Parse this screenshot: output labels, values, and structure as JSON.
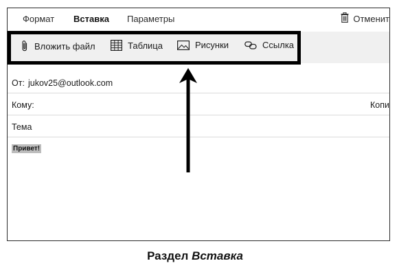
{
  "menu": {
    "tabs": [
      {
        "label": "Формат"
      },
      {
        "label": "Вставка"
      },
      {
        "label": "Параметры"
      }
    ],
    "discard_label": "Отменит"
  },
  "toolbar": {
    "items": [
      {
        "label": "Вложить файл",
        "icon": "paperclip-icon"
      },
      {
        "label": "Таблица",
        "icon": "table-icon"
      },
      {
        "label": "Рисунки",
        "icon": "picture-icon"
      },
      {
        "label": "Ссылка",
        "icon": "link-icon"
      }
    ]
  },
  "compose": {
    "from_label": "От:",
    "from_value": "jukov25@outlook.com",
    "to_label": "Кому:",
    "copy_label": "Копи",
    "subject_label": "Тема",
    "body_text": "Привет!"
  },
  "caption": {
    "prefix": "Раздел ",
    "emphasis": "Вставка"
  },
  "colors": {
    "frame": "#000000",
    "toolbar_bg": "#f0f0f0",
    "highlight": "#bdbdbd"
  }
}
